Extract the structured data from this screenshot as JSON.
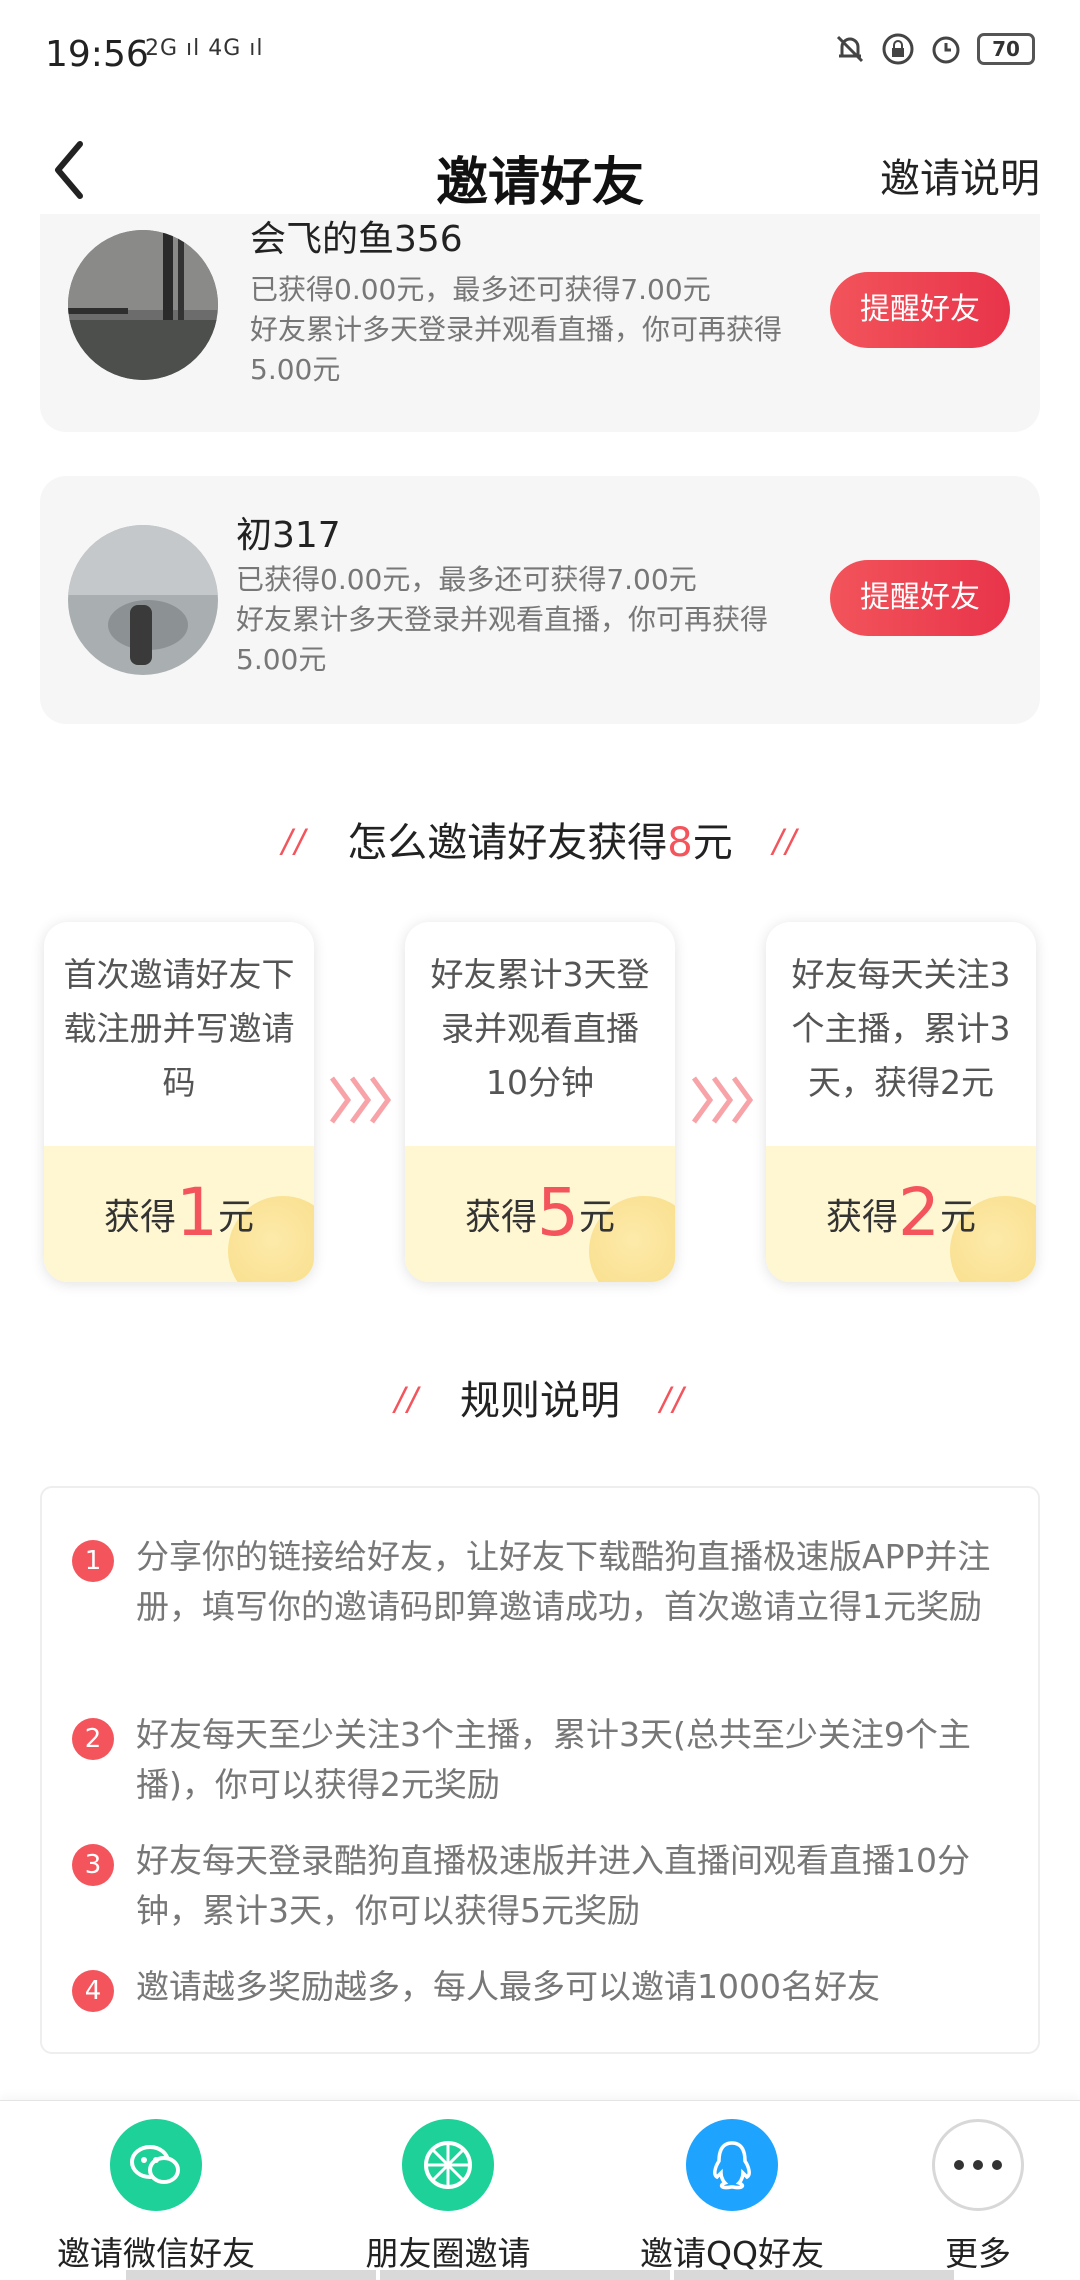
{
  "status_bar": {
    "time": "19:56",
    "signal": "2G ıl 4G ıl",
    "battery": "70"
  },
  "header": {
    "title": "邀请好友",
    "right_link": "邀请说明"
  },
  "friends": [
    {
      "name": "会飞的鱼356",
      "earned": "已获得0.00元，最多还可获得7.00元",
      "desc": "好友累计多天登录并观看直播，你可再获得5.00元",
      "button": "提醒好友"
    },
    {
      "name": "初317",
      "earned": "已获得0.00元，最多还可获得7.00元",
      "desc": "好友累计多天登录并观看直播，你可再获得5.00元",
      "button": "提醒好友"
    }
  ],
  "how_to": {
    "title_prefix": "怎么邀请好友获得",
    "title_amount": "8",
    "title_suffix": "元",
    "steps": [
      {
        "text": "首次邀请好友下载注册并写邀请码",
        "reward_prefix": "获得",
        "amount": "1",
        "reward_suffix": "元"
      },
      {
        "text": "好友累计3天登录并观看直播10分钟",
        "reward_prefix": "获得",
        "amount": "5",
        "reward_suffix": "元"
      },
      {
        "text": "好友每天关注3个主播，累计3天，获得2元",
        "reward_prefix": "获得",
        "amount": "2",
        "reward_suffix": "元"
      }
    ]
  },
  "rules": {
    "title": "规则说明",
    "items": [
      {
        "num": "1",
        "text": "分享你的链接给好友，让好友下载酷狗直播极速版APP并注册，填写你的邀请码即算邀请成功，首次邀请立得1元奖励"
      },
      {
        "num": "2",
        "text": "好友每天至少关注3个主播，累计3天(总共至少关注9个主播)，你可以获得2元奖励"
      },
      {
        "num": "3",
        "text": "好友每天登录酷狗直播极速版并进入直播间观看直播10分钟，累计3天，你可以获得5元奖励"
      },
      {
        "num": "4",
        "text": "邀请越多奖励越多，每人最多可以邀请1000名好友"
      }
    ]
  },
  "share": [
    {
      "label": "邀请微信好友",
      "icon": "wechat-icon",
      "color": "#1dd199"
    },
    {
      "label": "朋友圈邀请",
      "icon": "moments-icon",
      "color": "#1dd199"
    },
    {
      "label": "邀请QQ好友",
      "icon": "qq-icon",
      "color": "#1ea4ff"
    },
    {
      "label": "更多",
      "icon": "more-icon",
      "color": "#ffffff"
    }
  ],
  "colors": {
    "accent": "#f4545c",
    "card_bg": "#f6f6f6",
    "reward_bg": "#fff7d1"
  }
}
